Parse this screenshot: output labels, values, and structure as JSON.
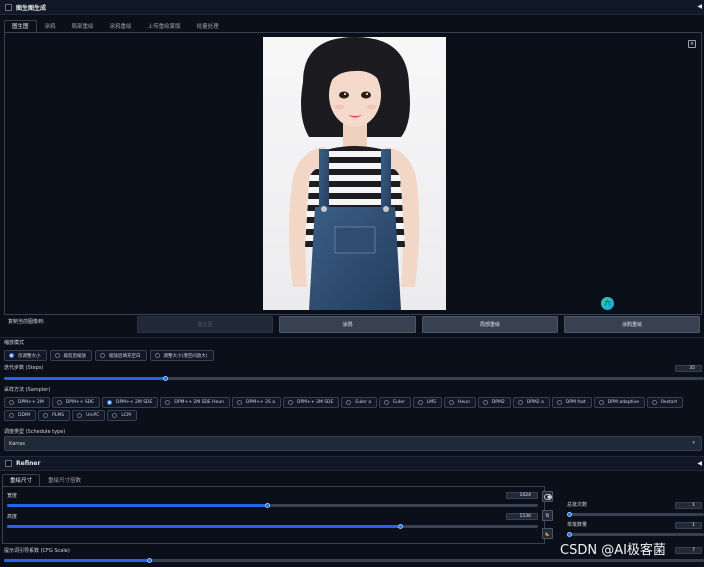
{
  "accordion_top": {
    "title": "图生图生成"
  },
  "top_tabs": [
    {
      "label": "图生图"
    },
    {
      "label": "涂鸦"
    },
    {
      "label": "局部重绘"
    },
    {
      "label": "涂鸦重绘"
    },
    {
      "label": "上传重绘蒙版"
    },
    {
      "label": "批量处理"
    }
  ],
  "copy_row": {
    "label": "复制当前图像到:",
    "buttons": [
      {
        "label": "图生图",
        "disabled": true
      },
      {
        "label": "涂鸦",
        "disabled": false
      },
      {
        "label": "局部重绘",
        "disabled": false
      },
      {
        "label": "涂鸦重绘",
        "disabled": false
      }
    ]
  },
  "resize_mode": {
    "label": "缩放模式",
    "options": [
      "仅调整大小",
      "裁剪后缩放",
      "缩放后填充空白",
      "调整大小(潜空间放大)"
    ],
    "selected": 0
  },
  "steps": {
    "label": "迭代步数 (Steps)",
    "value": "35",
    "fraction": 0.23
  },
  "sampler": {
    "label": "采样方法 (Sampler)",
    "options": [
      "DPM++ 2M",
      "DPM++ SDE",
      "DPM++ 2M SDE",
      "DPM++ 2M SDE Heun",
      "DPM++ 2S a",
      "DPM++ 3M SDE",
      "Euler a",
      "Euler",
      "LMS",
      "Heun",
      "DPM2",
      "DPM2 a",
      "DPM fast",
      "DPM adaptive",
      "Restart",
      "DDIM",
      "PLMS",
      "UniPC",
      "LCM"
    ],
    "selected": 2
  },
  "schedule": {
    "label": "调度类型 (Schedule type)",
    "value": "Karras"
  },
  "refiner": {
    "title": "Refiner"
  },
  "size_tabs": [
    {
      "label": "重绘尺寸"
    },
    {
      "label": "重绘尺寸倍数"
    }
  ],
  "width": {
    "label": "宽度",
    "value": "1024",
    "fraction": 0.49
  },
  "height": {
    "label": "高度",
    "value": "1536",
    "fraction": 0.74
  },
  "size_buttons": {
    "swap": "⇅",
    "lock": "◣"
  },
  "batch_count": {
    "label": "总批次数",
    "value": "1"
  },
  "batch_size": {
    "label": "单批数量",
    "value": "1"
  },
  "cfg": {
    "label": "提示词引导系数 (CFG Scale)",
    "value": "7"
  },
  "watermark": "CSDN @AI极客菌",
  "colors": {
    "accent": "#2563eb",
    "bg": "#0b0f19",
    "panel": "#111827"
  }
}
